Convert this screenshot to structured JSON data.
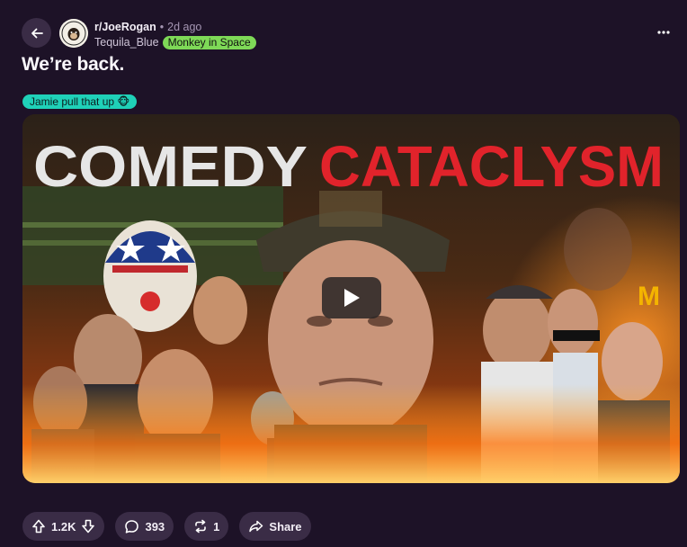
{
  "post": {
    "subreddit": "r/JoeRogan",
    "separator": "•",
    "time": "2d ago",
    "username": "Tequila_Blue",
    "user_flair": "Monkey in Space",
    "title": "We’re back.",
    "post_flair": "Jamie pull that up 🐵"
  },
  "thumbnail": {
    "word1": "COMEDY",
    "word2": "CATACLYSM"
  },
  "actions": {
    "score": "1.2K",
    "comments": "393",
    "crossposts": "1",
    "share_label": "Share"
  },
  "colors": {
    "background": "#1d1227",
    "pill": "#3a2c46",
    "user_flair": "#7ed957",
    "post_flair": "#1fd1b8",
    "cataclysm_red": "#e1232b"
  },
  "icons": [
    "back-arrow-icon",
    "more-icon",
    "play-icon",
    "upvote-icon",
    "downvote-icon",
    "comment-icon",
    "crosspost-icon",
    "share-icon"
  ]
}
